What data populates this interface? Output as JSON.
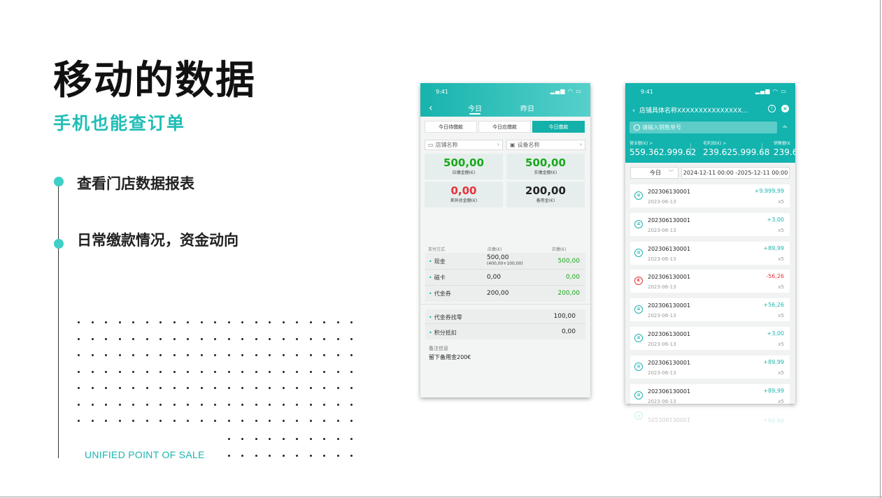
{
  "slide": {
    "headline": "移动的数据",
    "subhead": "手机也能查订单",
    "bullets": [
      "查看门店数据报表",
      "日常缴款情况，资金动向"
    ],
    "footer_brand": "UNIFIED POINT OF SALE"
  },
  "colors": {
    "accent": "#21bdb6",
    "green": "#1aa81a",
    "red": "#e8323b"
  },
  "phone1": {
    "status_time": "9:41",
    "status_icons": "signal-wifi-battery",
    "tabs": [
      "今日",
      "昨日"
    ],
    "segments": [
      "今日待缴款",
      "今日应缴款",
      "今日缴款"
    ],
    "filters": [
      "店铺名称",
      "设备名称"
    ],
    "stats": [
      {
        "value": "500,00",
        "label": "应缴金额(€)"
      },
      {
        "value": "500,00",
        "label": "实缴金额(€)"
      },
      {
        "value": "0,00",
        "label": "差异总金额(€)"
      },
      {
        "value": "200,00",
        "label": "备用金(€)"
      }
    ],
    "pay_headers": [
      "支付方式",
      "应缴(€)",
      "实缴(€)"
    ],
    "payments": [
      {
        "name": "现金",
        "due": "500,00",
        "due_detail": "(400,00+100,00)",
        "paid": "500,00"
      },
      {
        "name": "磁卡",
        "due": "0,00",
        "due_detail": "",
        "paid": "0,00"
      },
      {
        "name": "代金券",
        "due": "200,00",
        "due_detail": "",
        "paid": "200,00"
      }
    ],
    "extras": [
      {
        "name": "代金券找零",
        "value": "100,00"
      },
      {
        "name": "积分抵扣",
        "value": "0,00"
      }
    ],
    "note_label": "备注信息",
    "note_value": "留下备用金200€"
  },
  "phone2": {
    "status_time": "9:41",
    "title": "店铺具体名称XXXXXXXXXXXXXXX...",
    "search_placeholder": "请输入销售单号",
    "metrics": [
      {
        "label": "营业额(€) >",
        "value": "559.362.999.62"
      },
      {
        "label": "毛利润(€) >",
        "value": "239.625.999.68"
      },
      {
        "label": "销售额(€",
        "value": "239.6"
      }
    ],
    "day_select": "今日",
    "date_range": "2024-12-11 00:00 -2025-12-11 00:00",
    "orders": [
      {
        "no": "202306130001",
        "date": "2023-06-13",
        "amount": "+9.999,99",
        "qty": "x5",
        "negative": false
      },
      {
        "no": "202306130001",
        "date": "2023-06-13",
        "amount": "+3,00",
        "qty": "x5",
        "negative": false
      },
      {
        "no": "202306130001",
        "date": "2023-06-13",
        "amount": "+89,99",
        "qty": "x5",
        "negative": false
      },
      {
        "no": "202306130001",
        "date": "2023-06-13",
        "amount": "-56,26",
        "qty": "x5",
        "negative": true
      },
      {
        "no": "202306130001",
        "date": "2023-06-13",
        "amount": "+56,26",
        "qty": "x5",
        "negative": false
      },
      {
        "no": "202306130001",
        "date": "2023-06-13",
        "amount": "+3,00",
        "qty": "x5",
        "negative": false
      },
      {
        "no": "202306130001",
        "date": "2023-06-13",
        "amount": "+89,99",
        "qty": "x5",
        "negative": false
      },
      {
        "no": "202306130001",
        "date": "2023-06-13",
        "amount": "+89,99",
        "qty": "x5",
        "negative": false
      }
    ]
  }
}
